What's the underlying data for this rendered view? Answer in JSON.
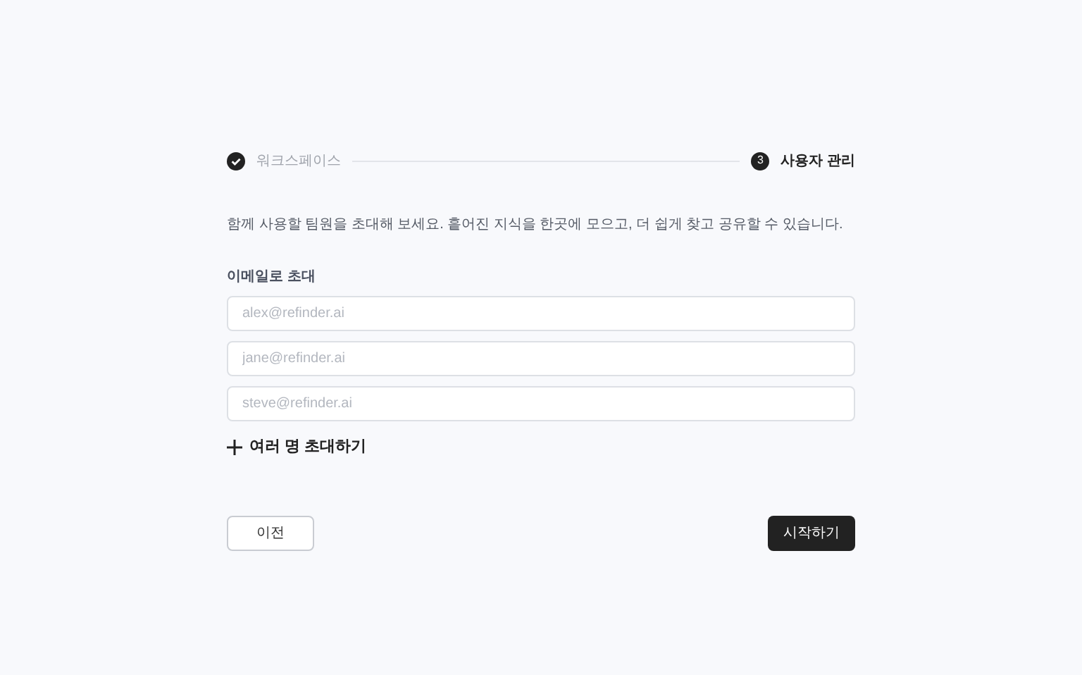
{
  "steps": [
    {
      "label": "워크스페이스",
      "completed": true,
      "selected": false
    },
    {
      "label": "사용자 관리",
      "number": "3",
      "completed": false,
      "selected": true
    }
  ],
  "description": "함께 사용할 팀원을 초대해 보세요. 흩어진 지식을 한곳에 모으고, 더 쉽게 찾고 공유할 수 있습니다.",
  "invite": {
    "label": "이메일로 초대",
    "fields": [
      {
        "placeholder": "alex@refinder.ai"
      },
      {
        "placeholder": "jane@refinder.ai"
      },
      {
        "placeholder": "steve@refinder.ai"
      }
    ],
    "add_more": "여러 명 초대하기"
  },
  "buttons": {
    "back": "이전",
    "start": "시작하기"
  }
}
